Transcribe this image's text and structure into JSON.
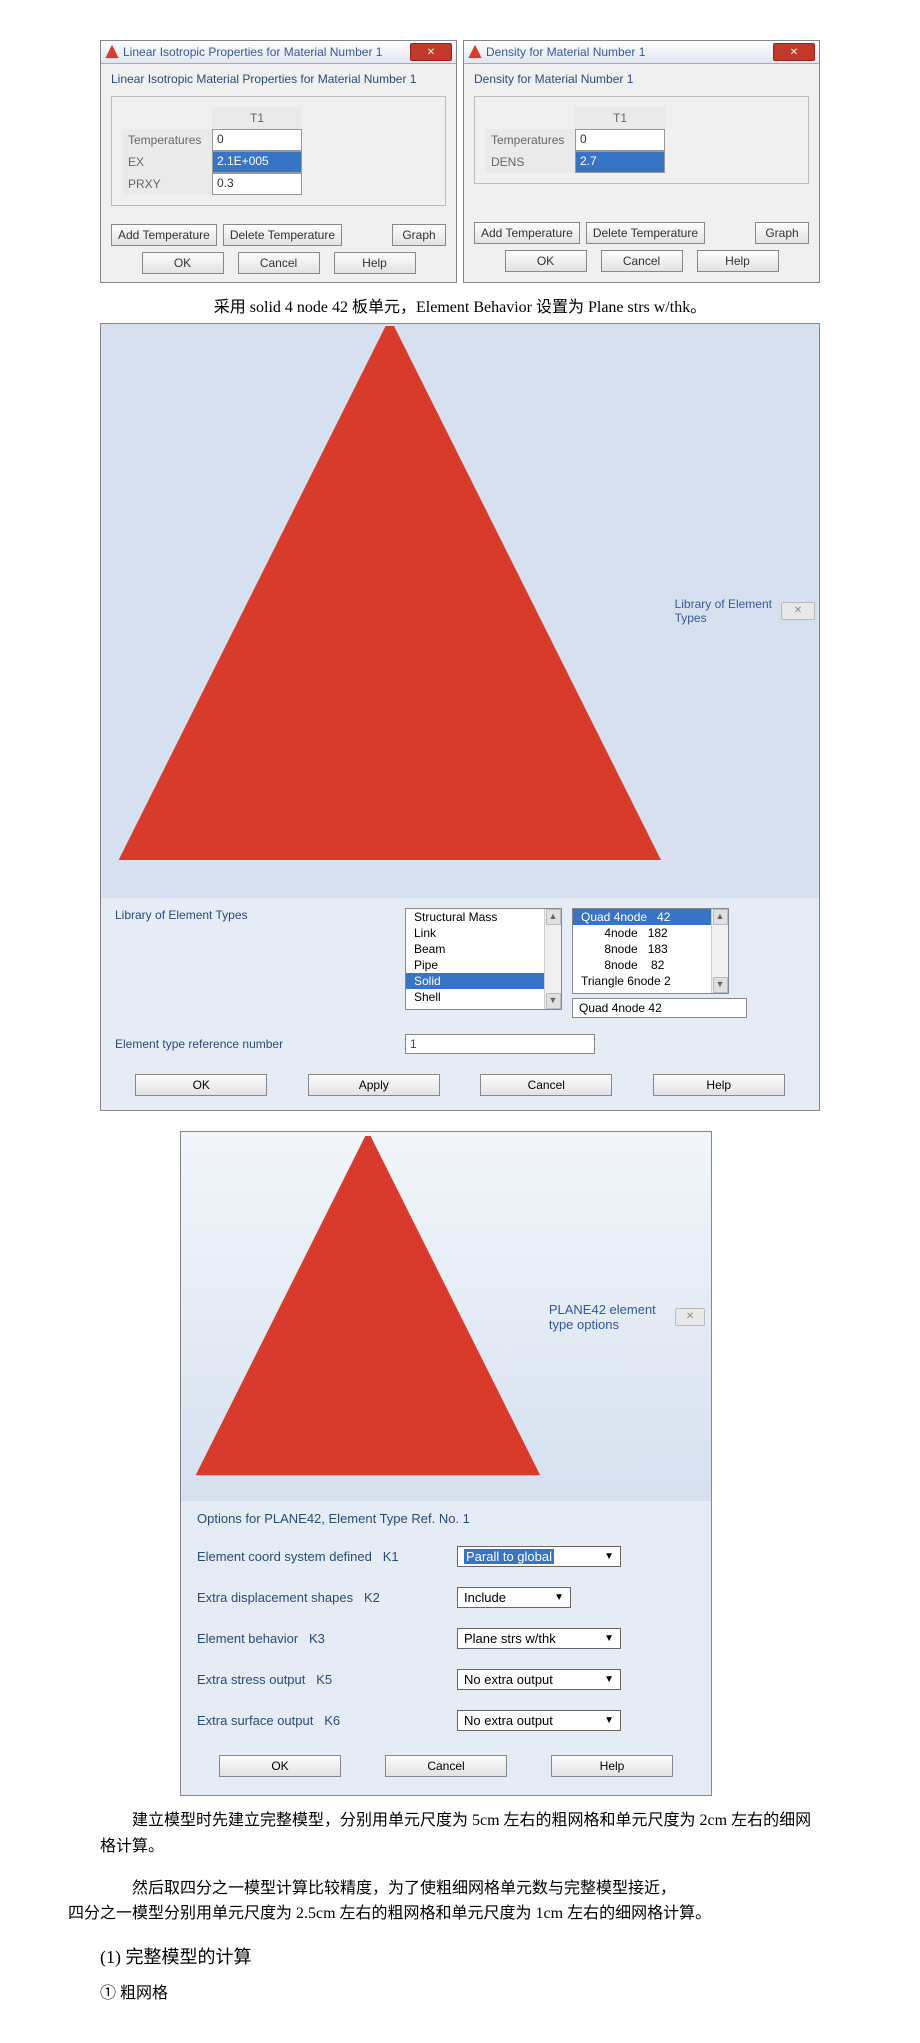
{
  "dialog_iso": {
    "title": "Linear Isotropic Properties for Material Number 1",
    "heading": "Linear Isotropic Material Properties for Material Number 1",
    "t_header": "T1",
    "rows": {
      "temp_label": "Temperatures",
      "temp_val": "0",
      "ex_label": "EX",
      "ex_val": "2.1E+005",
      "prxy_label": "PRXY",
      "prxy_val": "0.3"
    },
    "buttons": {
      "add_temp": "Add Temperature",
      "del_temp": "Delete Temperature",
      "graph": "Graph",
      "ok": "OK",
      "cancel": "Cancel",
      "help": "Help"
    }
  },
  "dialog_dens": {
    "title": "Density for Material Number 1",
    "heading": "Density for Material Number 1",
    "t_header": "T1",
    "rows": {
      "temp_label": "Temperatures",
      "temp_val": "0",
      "dens_label": "DENS",
      "dens_val": "2.7"
    },
    "buttons": {
      "add_temp": "Add Temperature",
      "del_temp": "Delete Temperature",
      "graph": "Graph",
      "ok": "OK",
      "cancel": "Cancel",
      "help": "Help"
    }
  },
  "caption_solid": "采用 solid 4 node 42 板单元，Element Behavior 设置为 Plane strs w/thk。",
  "dialog_lib": {
    "title": "Library of Element Types",
    "label": "Library of Element Types",
    "left_list": [
      "Structural Mass",
      "Link",
      "Beam",
      "Pipe",
      "Solid",
      "Shell"
    ],
    "left_selected": "Solid",
    "right_list": [
      "Quad 4node   42",
      "       4node   182",
      "       8node   183",
      "       8node    82",
      "Triangle 6node 2"
    ],
    "right_selected": "Quad 4node   42",
    "right_selbox": "Quad 4node   42",
    "ref_label": "Element type reference number",
    "ref_value": "1",
    "buttons": {
      "ok": "OK",
      "apply": "Apply",
      "cancel": "Cancel",
      "help": "Help"
    }
  },
  "dialog_opts": {
    "title": "PLANE42 element type options",
    "header": "Options for PLANE42, Element Type Ref. No. 1",
    "rows": [
      {
        "label": "Element coord system defined",
        "key": "K1",
        "value": "Parall to global",
        "selected": true,
        "short": false
      },
      {
        "label": "Extra displacement shapes",
        "key": "K2",
        "value": "Include",
        "selected": false,
        "short": true
      },
      {
        "label": "Element behavior",
        "key": "K3",
        "value": "Plane strs w/thk",
        "selected": false,
        "short": false
      },
      {
        "label": "Extra stress output",
        "key": "K5",
        "value": "No extra output",
        "selected": false,
        "short": false
      },
      {
        "label": "Extra surface output",
        "key": "K6",
        "value": "No extra output",
        "selected": false,
        "short": false
      }
    ],
    "buttons": {
      "ok": "OK",
      "cancel": "Cancel",
      "help": "Help"
    }
  },
  "paragraphs": {
    "p1": "建立模型时先建立完整模型，分别用单元尺度为 5cm 左右的粗网格和单元尺度为 2cm 左右的细网格计算。",
    "p2a": "然后取四分之一模型计算比较精度，为了使粗细网格单元数与完整模型接近，",
    "p2b": "四分之一模型分别用单元尺度为 2.5cm 左右的粗网格和单元尺度为 1cm 左右的细网格计算。",
    "h2": "(1) 完整模型的计算",
    "h3": "① 粗网格"
  }
}
